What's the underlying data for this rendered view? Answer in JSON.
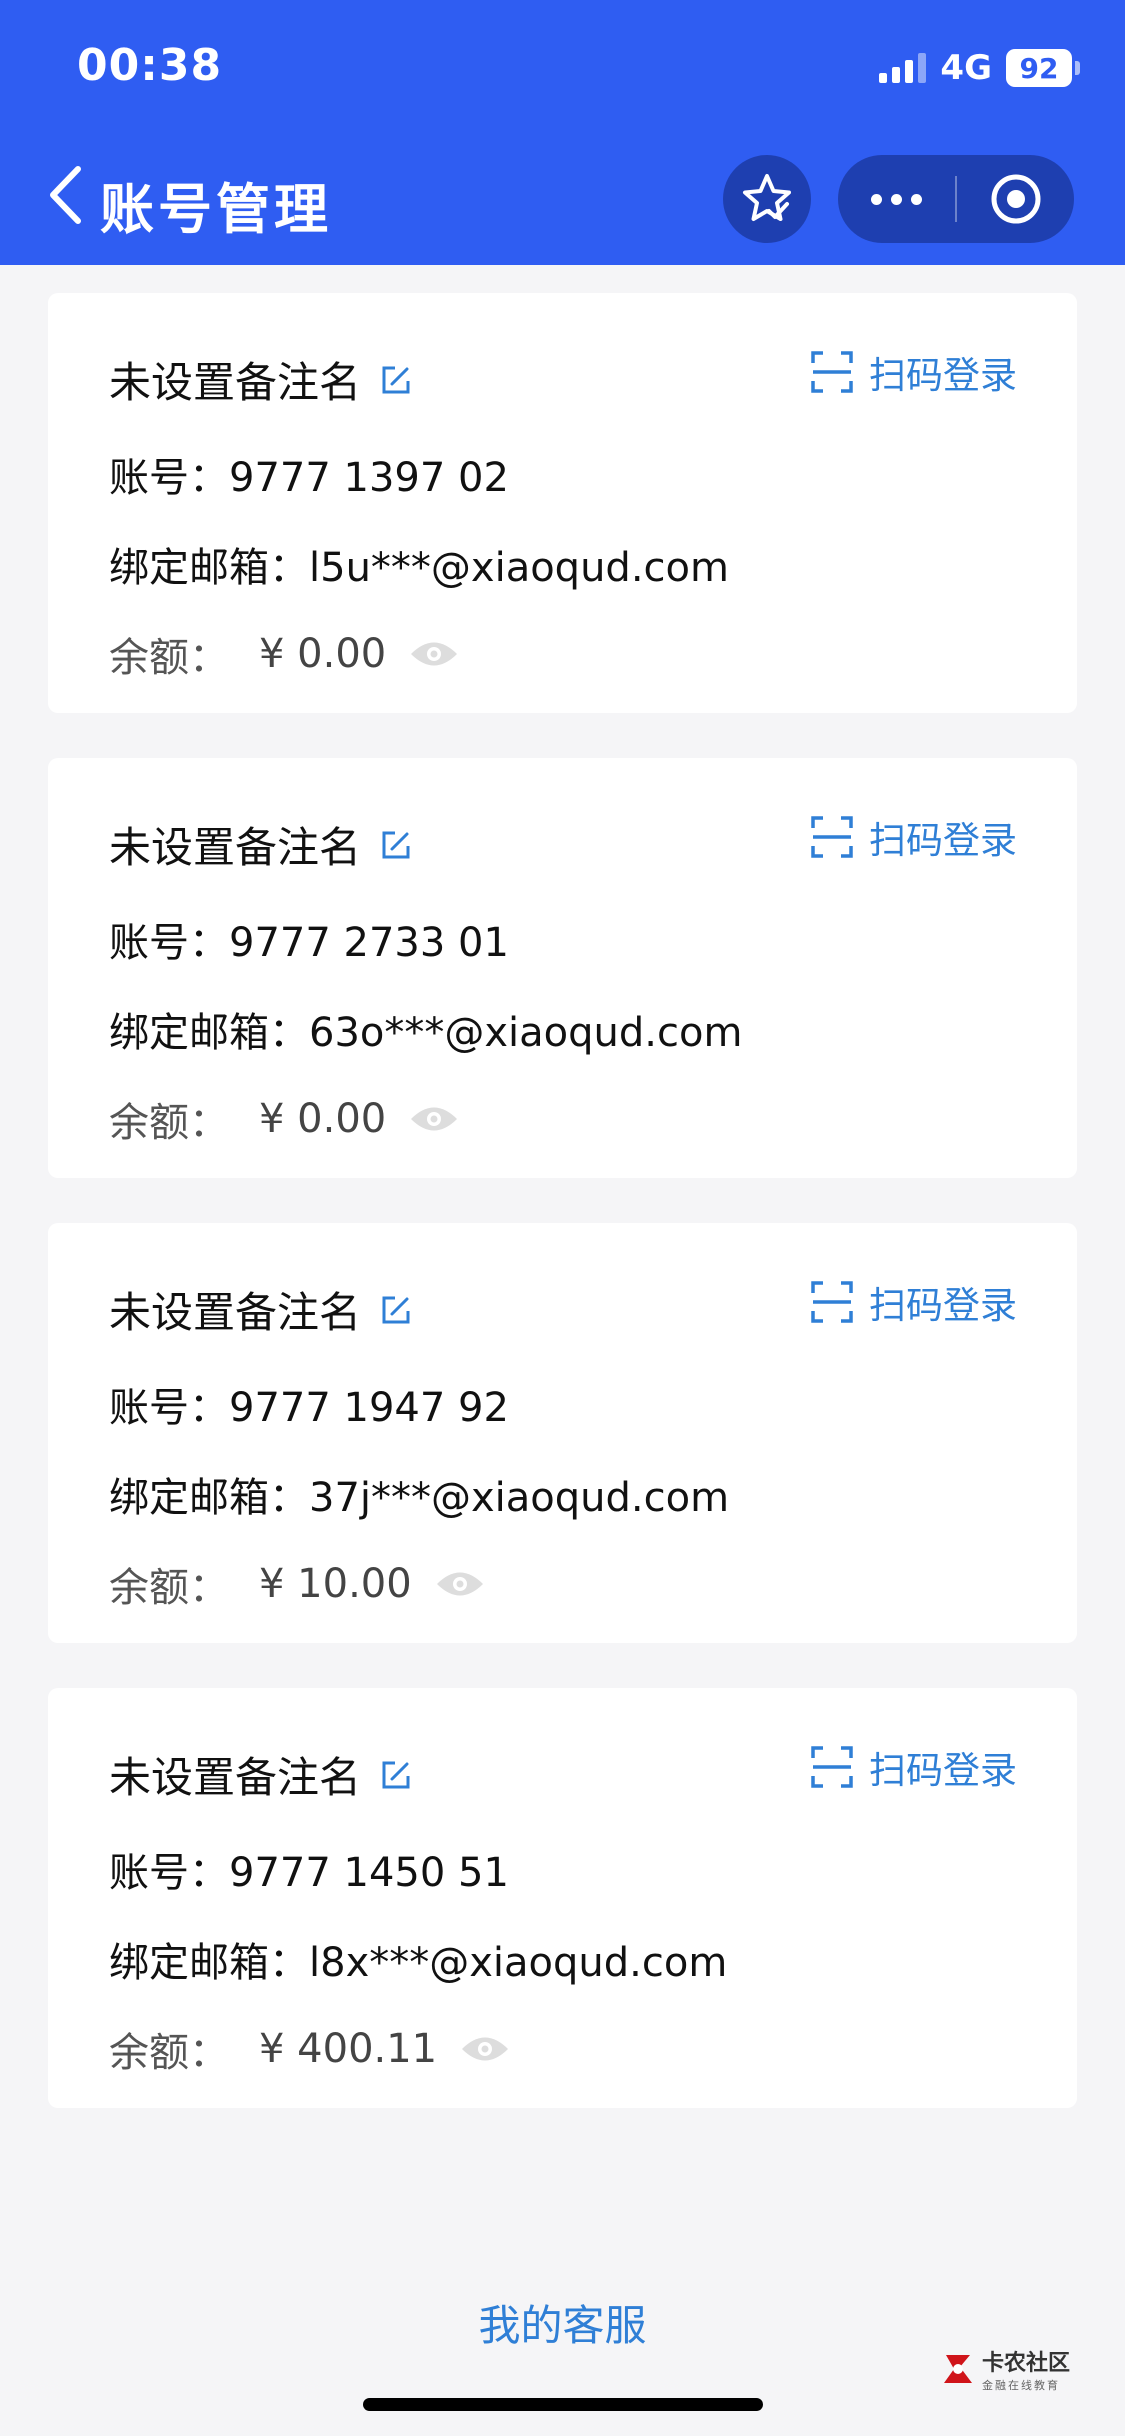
{
  "status_bar": {
    "time": "00:38",
    "network": "4G",
    "battery": "92"
  },
  "nav": {
    "title": "账号管理"
  },
  "accounts": [
    {
      "name": "未设置备注名",
      "scan_label": "扫码登录",
      "account_label": "账号：",
      "account_no": "9777 1397 02",
      "email_label": "绑定邮箱：",
      "email": "l5u***@xiaoqud.com",
      "balance_label": "余额：",
      "balance": "¥ 0.00"
    },
    {
      "name": "未设置备注名",
      "scan_label": "扫码登录",
      "account_label": "账号：",
      "account_no": "9777 2733 01",
      "email_label": "绑定邮箱：",
      "email": "63o***@xiaoqud.com",
      "balance_label": "余额：",
      "balance": "¥ 0.00"
    },
    {
      "name": "未设置备注名",
      "scan_label": "扫码登录",
      "account_label": "账号：",
      "account_no": "9777 1947 92",
      "email_label": "绑定邮箱：",
      "email": "37j***@xiaoqud.com",
      "balance_label": "余额：",
      "balance": "¥ 10.00"
    },
    {
      "name": "未设置备注名",
      "scan_label": "扫码登录",
      "account_label": "账号：",
      "account_no": "9777 1450 51",
      "email_label": "绑定邮箱：",
      "email": "l8x***@xiaoqud.com",
      "balance_label": "余额：",
      "balance": "¥ 400.11"
    }
  ],
  "footer": {
    "service_link": "我的客服",
    "watermark_main": "卡农社区",
    "watermark_sub": "金融在线教育"
  },
  "colors": {
    "header_bg": "#2f5df2",
    "accent": "#2f7fd6"
  }
}
